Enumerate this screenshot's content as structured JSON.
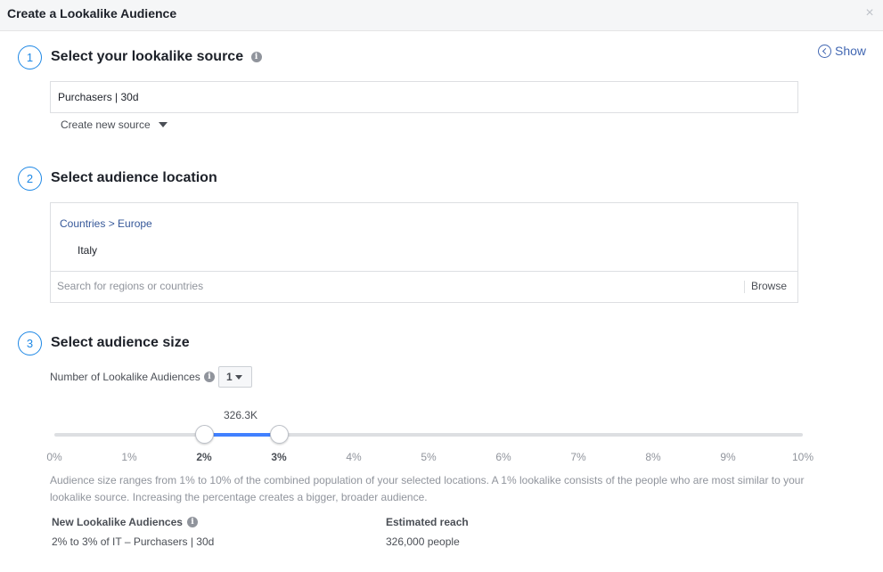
{
  "header": {
    "title": "Create a Lookalike Audience",
    "close_glyph": "×"
  },
  "show": {
    "label": "Show"
  },
  "steps": [
    {
      "number": "1",
      "title": "Select your lookalike source"
    },
    {
      "number": "2",
      "title": "Select audience location"
    },
    {
      "number": "3",
      "title": "Select audience size"
    }
  ],
  "source": {
    "value": "Purchasers | 30d",
    "create_label": "Create new source"
  },
  "location": {
    "breadcrumb": "Countries > Europe",
    "selected": "Italy",
    "search_placeholder": "Search for regions or countries",
    "browse_label": "Browse"
  },
  "size": {
    "count_label": "Number of Lookalike Audiences",
    "count_value": "1",
    "slider_label": "326.3K",
    "slider_min_percent": 2,
    "slider_max_percent": 3,
    "ticks": [
      "0%",
      "1%",
      "2%",
      "3%",
      "4%",
      "5%",
      "6%",
      "7%",
      "8%",
      "9%",
      "10%"
    ],
    "description": "Audience size ranges from 1% to 10% of the combined population of your selected locations. A 1% lookalike consists of the people who are most similar to your lookalike source. Increasing the percentage creates a bigger, broader audience."
  },
  "summary": {
    "audiences_title": "New Lookalike Audiences",
    "audiences_value": "2% to 3% of IT – Purchasers | 30d",
    "reach_title": "Estimated reach",
    "reach_value": "326,000 people"
  },
  "colors": {
    "accent": "#1e88e5",
    "link": "#365899",
    "slider_fill": "#4080ff"
  }
}
